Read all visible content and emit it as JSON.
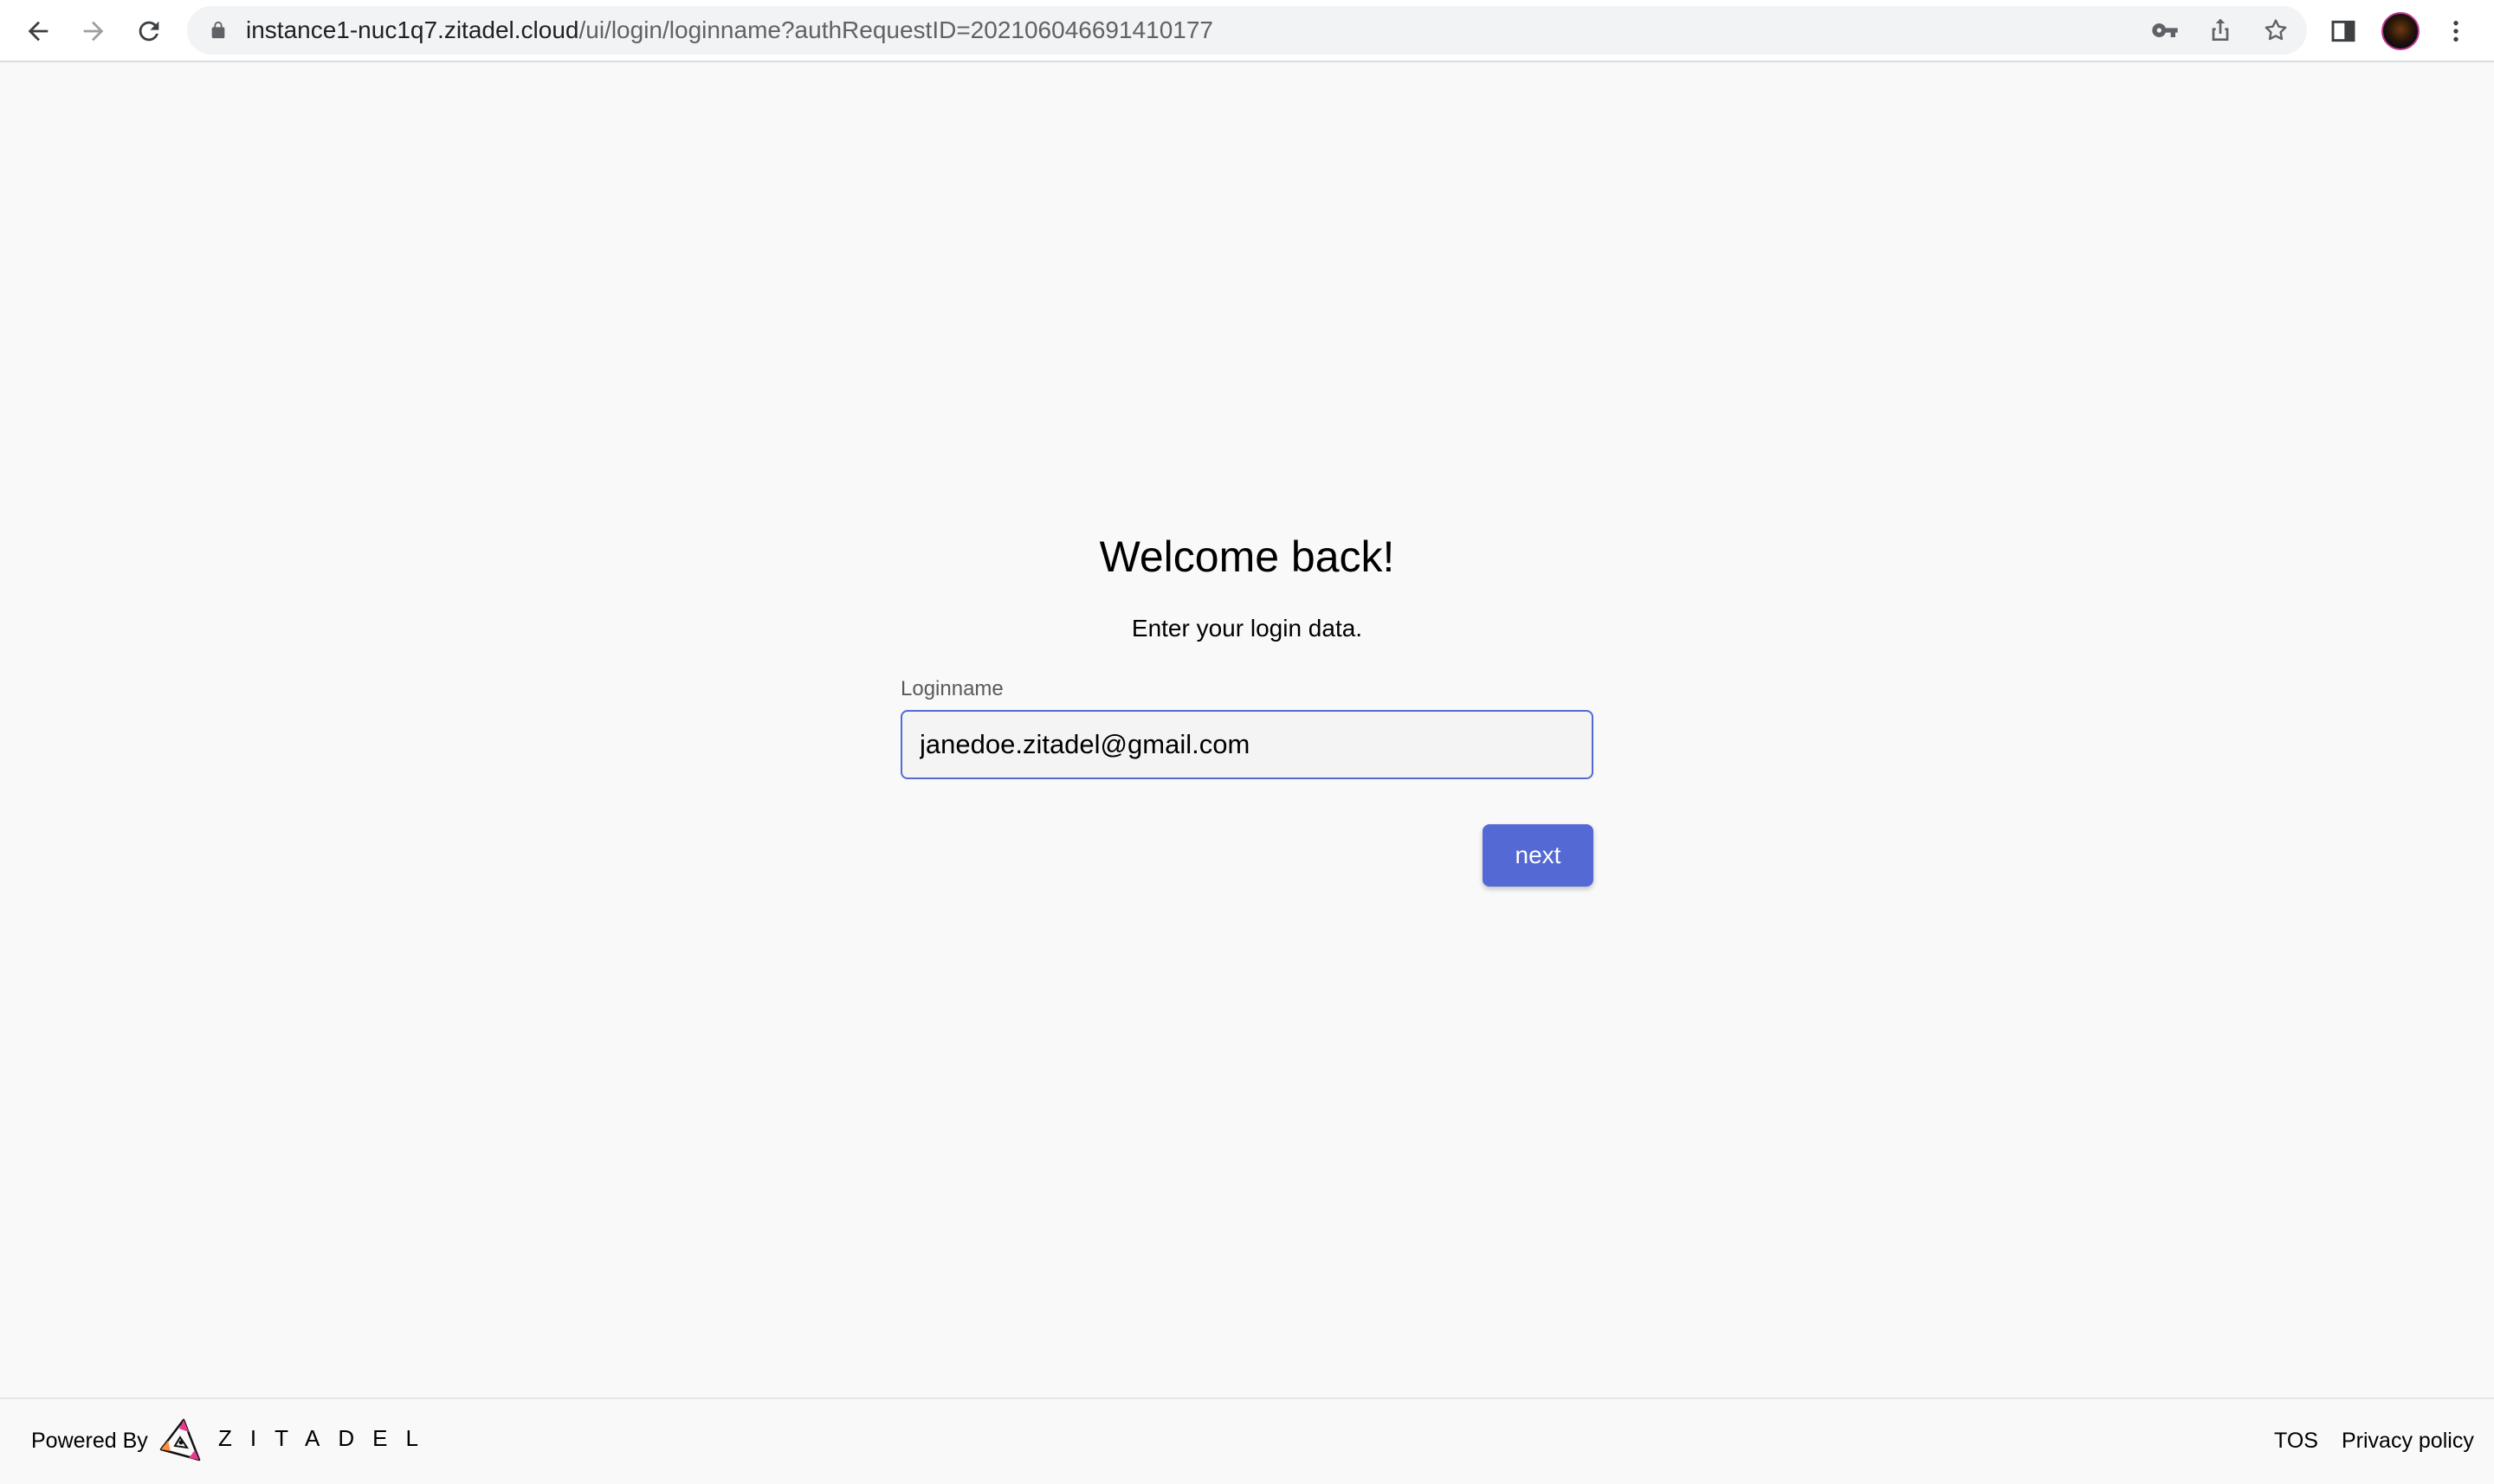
{
  "browser": {
    "url_host": "instance1-nuc1q7.zitadel.cloud",
    "url_path": "/ui/login/loginname?authRequestID=202106046691410177",
    "icons": {
      "back": "arrow-left-icon",
      "forward": "arrow-right-icon",
      "reload": "reload-icon",
      "lock": "lock-icon",
      "key": "key-icon",
      "share": "share-icon",
      "star": "star-icon",
      "sidepanel": "side-panel-icon",
      "menu": "kebab-menu-icon"
    }
  },
  "login": {
    "title": "Welcome back!",
    "subtitle": "Enter your login data.",
    "field_label": "Loginname",
    "field_value": "janedoe.zitadel@gmail.com",
    "next_label": "next"
  },
  "footer": {
    "powered_by": "Powered By",
    "brand": "ZITADEL",
    "tos": "TOS",
    "privacy": "Privacy policy"
  },
  "colors": {
    "accent": "#5469d4",
    "page_bg": "#f9f9f9",
    "input_bg": "#f4f4f4"
  }
}
